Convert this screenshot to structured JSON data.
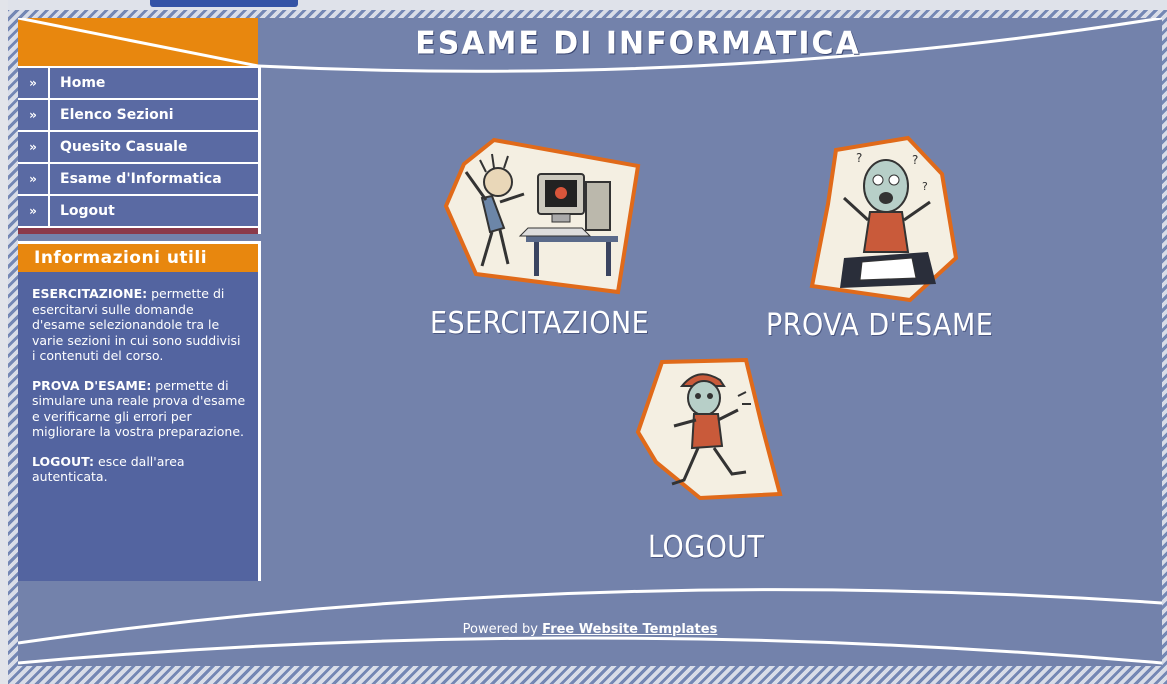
{
  "site": {
    "title": "ESAME DI INFORMATICA"
  },
  "nav": {
    "arrow": "»",
    "items": [
      {
        "label": "Home"
      },
      {
        "label": "Elenco Sezioni"
      },
      {
        "label": "Quesito Casuale"
      },
      {
        "label": "Esame d'Informatica"
      },
      {
        "label": "Logout"
      }
    ]
  },
  "info": {
    "title": "Informazioni utili",
    "sections": [
      {
        "term": "ESERCITAZIONE:",
        "text": " permette di esercitarvi sulle domande d'esame selezionandole tra le varie sezioni in cui sono suddivisi i contenuti del corso."
      },
      {
        "term": "PROVA D'ESAME:",
        "text": " permette di simulare una reale prova d'esame e verificarne gli errori per migliorare la vostra preparazione."
      },
      {
        "term": "LOGOUT:",
        "text": " esce dall'area autenticata."
      }
    ]
  },
  "cards": {
    "esercitazione": {
      "label": "ESERCITAZIONE",
      "icon": "frustrated-computer-user-icon"
    },
    "prova": {
      "label": "PROVA D'ESAME",
      "icon": "confused-exam-taker-icon"
    },
    "logout": {
      "label": "LOGOUT",
      "icon": "running-man-icon"
    }
  },
  "footer": {
    "prefix": "Powered by ",
    "link": "Free Website Templates"
  },
  "colors": {
    "background": "#7382ab",
    "nav": "#5a6aa3",
    "accent": "#e8870e",
    "card_border": "#e06a1a"
  }
}
